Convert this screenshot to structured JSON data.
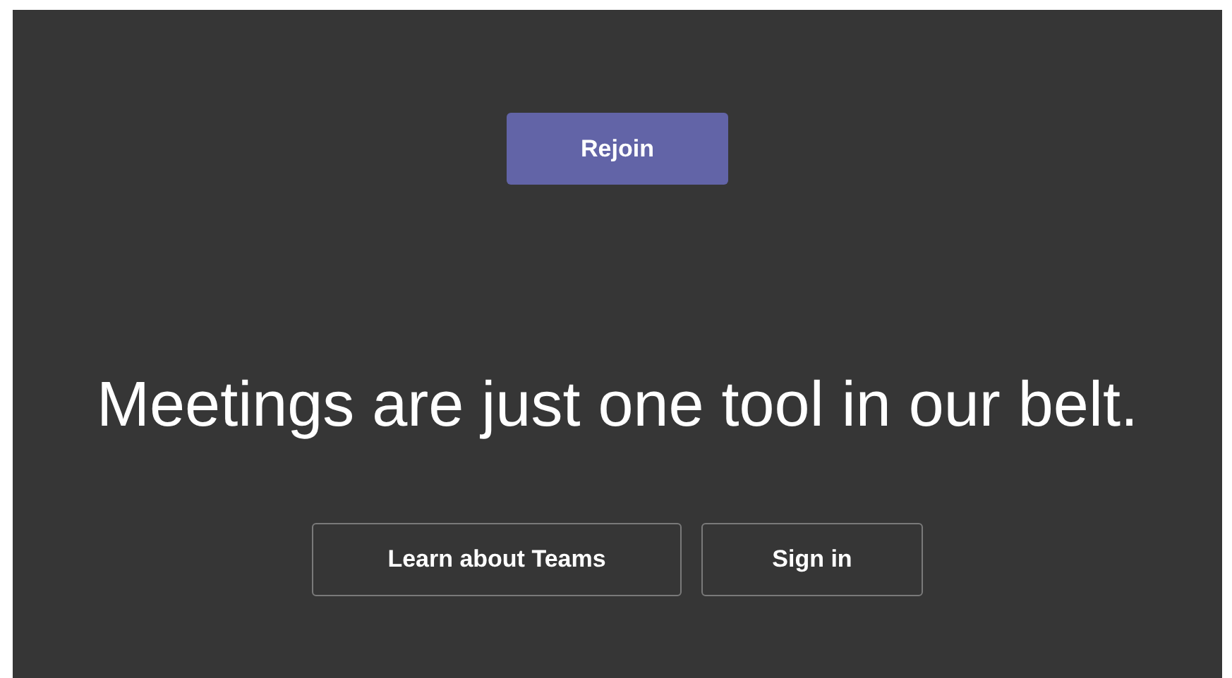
{
  "rejoin_button": {
    "label": "Rejoin"
  },
  "headline": "Meetings are just one tool in our belt.",
  "buttons": [
    {
      "label": "Learn about Teams"
    },
    {
      "label": "Sign in"
    }
  ]
}
